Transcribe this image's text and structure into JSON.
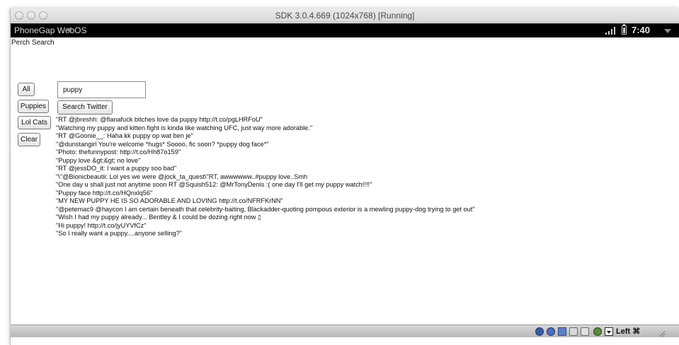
{
  "window": {
    "title": "SDK 3.0.4.669 (1024x768) [Running]"
  },
  "statusbar": {
    "app_name": "PhoneGap WebOS",
    "time": "7:40"
  },
  "app": {
    "title": "Perch Search",
    "buttons": {
      "all": "All",
      "puppies": "Puppies",
      "lolcats": "Lol Cats",
      "clear": "Clear",
      "search": "Search Twitter"
    },
    "search": {
      "value": "puppy"
    },
    "results": [
      "\"RT @jbreshh: @flanafuck bitches love da puppy http://t.co/pgLHRFoU\"",
      "\"Watching my puppy and kitten fight is kinda like watching UFC, just way more adorable.\"",
      "\"RT @Goonie__: Haha kk puppy op wat ben je\"",
      "\"@dunstangirl You're welcome *hugs* Soooo, fic soon? *puppy dog face*\"",
      "\"Photo: thefunnypost: http://t.co/Hh87o159\"",
      "\"Puppy love &gt;&gt; no love\"",
      "\"RT @jessDO_it: I want a puppy soo bad\"",
      "\"\\\"@Bionicbeautii: Lol yes we were @jock_ta_quest\\\"RT, awwwwww..#puppy love..Smh",
      "\"One day u shall just not anytime soon RT @Squish512: @MrTonyDenis :( one day I'll get my puppy watch!!!!\"",
      "\"Puppy face http://t.co/HQnxlq56\"",
      "\"MY NEW PUPPY HE IS SO ADORABLE AND LOVING http://t.co/NFRFKrNN\"",
      "\"@petemac9 @haycon I am certain beneath that celebrity-baiting, Blackadder-quoting pompous exterior is a mewling puppy-dog trying to get out\"",
      "\"Wish I had my puppy already... Bentley & I could be dozing right now ▯",
      "\"Hi puppy! http://t.co/jyUYVfCz\"",
      "\"So I really want a puppy....anyone selling?\""
    ]
  },
  "bottombar": {
    "host_key": "Left ⌘",
    "icons": [
      "hard-disk-icon",
      "optical-drive-icon",
      "network-icon",
      "usb-icon",
      "screen-icon",
      "virtualbox-icon",
      "mouse-capture-icon"
    ]
  }
}
